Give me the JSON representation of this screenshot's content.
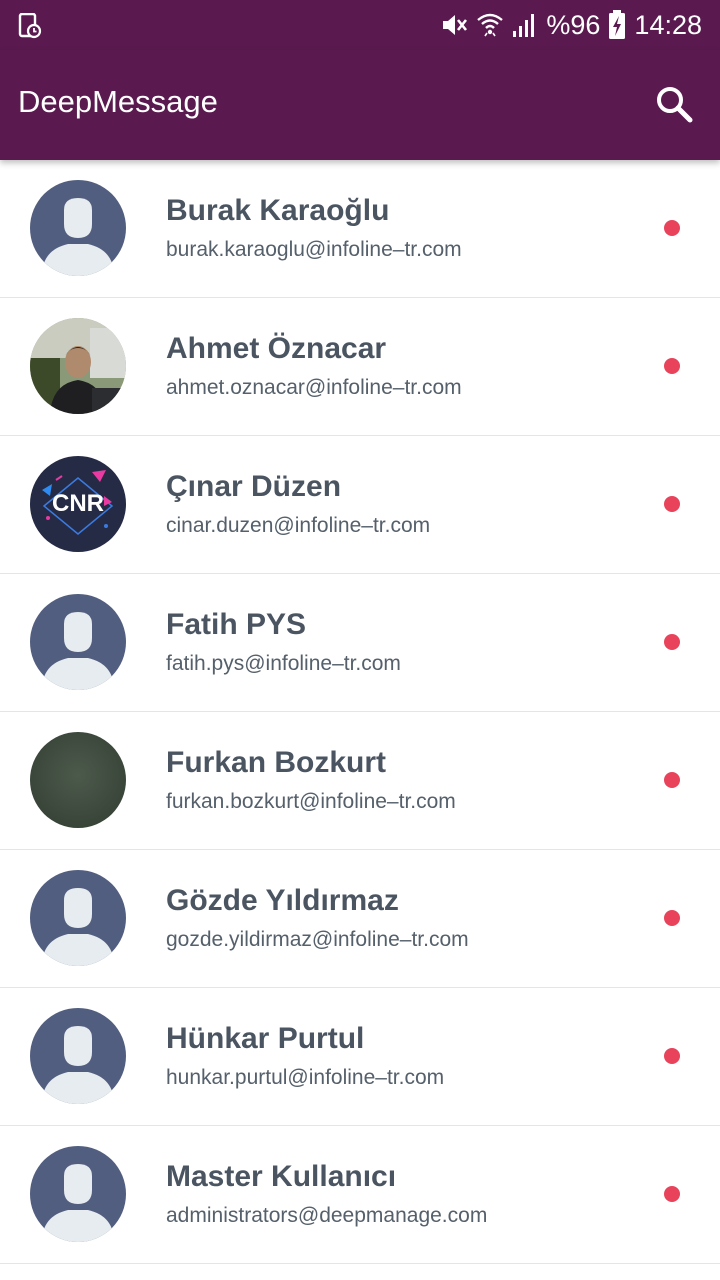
{
  "status_bar": {
    "battery_text": "%96",
    "time": "14:28",
    "icons": [
      "screen-record-icon",
      "mute-icon",
      "wifi-icon",
      "signal-icon",
      "battery-charging-icon"
    ]
  },
  "app_bar": {
    "title": "DeepMessage",
    "search_icon": "search-icon"
  },
  "colors": {
    "primary": "#5a1a4f",
    "name_text": "#4b5561",
    "email_text": "#55606b",
    "status_dot": "#e8435b",
    "avatar_default_bg": "#525e7f"
  },
  "contacts": [
    {
      "name": "Burak Karaoğlu",
      "email": "burak.karaoglu@infoline–tr.com",
      "avatar": "default-avatar",
      "status": "offline"
    },
    {
      "name": "Ahmet Öznacar",
      "email": "ahmet.oznacar@infoline–tr.com",
      "avatar": "photo",
      "status": "offline"
    },
    {
      "name": "Çınar Düzen",
      "email": "cinar.duzen@infoline–tr.com",
      "avatar": "logo",
      "avatar_text": "CNR",
      "status": "offline"
    },
    {
      "name": "Fatih PYS",
      "email": "fatih.pys@infoline–tr.com",
      "avatar": "default-avatar",
      "status": "offline"
    },
    {
      "name": "Furkan Bozkurt",
      "email": "furkan.bozkurt@infoline–tr.com",
      "avatar": "photo",
      "status": "offline"
    },
    {
      "name": "Gözde Yıldırmaz",
      "email": "gozde.yildirmaz@infoline–tr.com",
      "avatar": "default-avatar",
      "status": "offline"
    },
    {
      "name": "Hünkar Purtul",
      "email": "hunkar.purtul@infoline–tr.com",
      "avatar": "default-avatar",
      "status": "offline"
    },
    {
      "name": "Master Kullanıcı",
      "email": "administrators@deepmanage.com",
      "avatar": "default-avatar",
      "status": "offline"
    }
  ]
}
